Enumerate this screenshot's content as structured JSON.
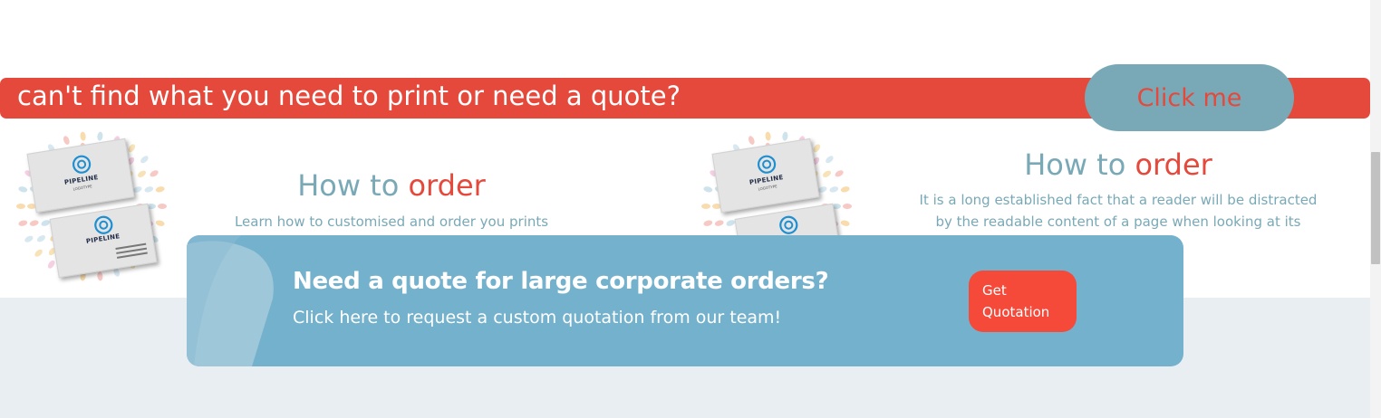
{
  "quote_bar": {
    "text": "can't find what you need to print or need a quote?",
    "button_label": "Click me"
  },
  "how_left": {
    "title_part1": "How to",
    "title_part2": "order",
    "description": "Learn how to customised and order you prints"
  },
  "how_right": {
    "title_part1": "How to",
    "title_part2": "order",
    "description": "It is a long established fact that a reader will be distracted by the readable content of a page when looking at its layout."
  },
  "card_art": {
    "brand": "PIPELINE",
    "sub": "LOGOTYPE"
  },
  "banner": {
    "title": "Need a quote for large corporate orders?",
    "subtitle": "Click here to request a custom quotation from our team!",
    "button_label": "Get Quotation"
  },
  "colors": {
    "accent_red": "#e5493c",
    "teal": "#79a9b6",
    "banner_blue": "#74b1cc",
    "button_red": "#f5493a",
    "footer_band": "#e8eef2"
  },
  "icons": {
    "card_logo": "circle-logo-icon"
  }
}
